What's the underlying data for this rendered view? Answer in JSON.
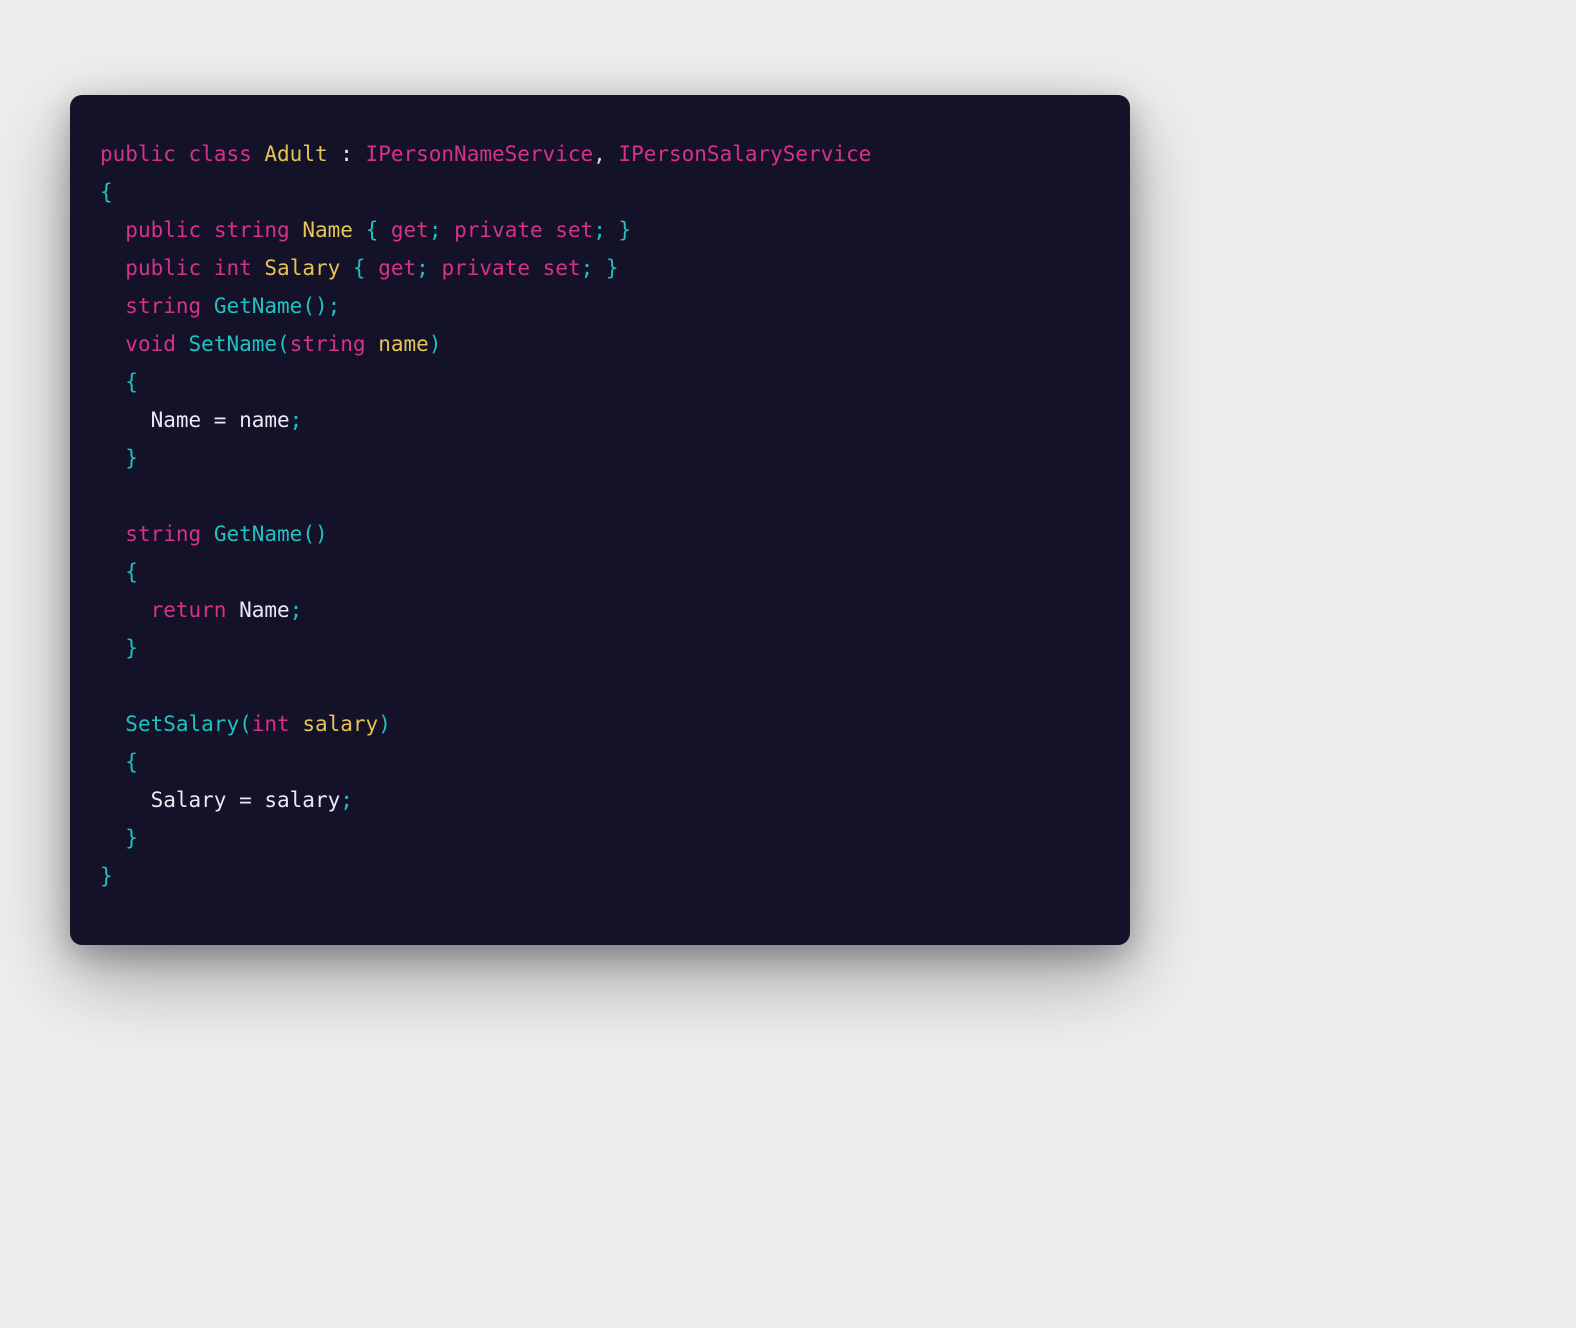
{
  "code": {
    "kw_public": "public",
    "kw_class": "class",
    "kw_private": "private",
    "kw_set": "set",
    "kw_get": "get",
    "kw_return": "return",
    "kw_string": "string",
    "kw_int": "int",
    "kw_void": "void",
    "cls_name": "Adult",
    "iface1": "IPersonNameService",
    "iface2": "IPersonSalaryService",
    "prop_name": "Name",
    "prop_salary": "Salary",
    "fn_getname": "GetName",
    "fn_setname": "SetName",
    "fn_setsalary": "SetSalary",
    "param_name": "name",
    "param_salary": "salary",
    "p_colon": " : ",
    "p_comma_sp": ", ",
    "p_obrace": "{",
    "p_cbrace": "}",
    "p_oparen": "(",
    "p_cparen": ")",
    "p_semi": ";",
    "p_eq": " = "
  }
}
